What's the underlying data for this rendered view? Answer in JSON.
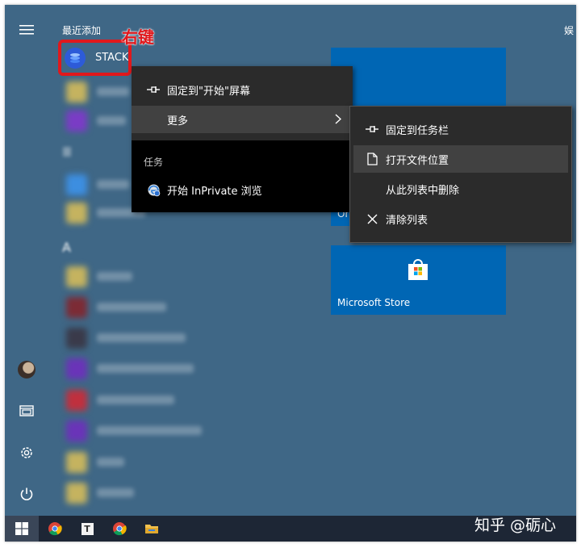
{
  "start_menu": {
    "section_recent": "最近添加",
    "right_edge_label": "娱",
    "apps": [
      {
        "label": "STACK"
      }
    ],
    "group_letter_a": "A"
  },
  "annotation": {
    "label": "右键",
    "color": "#e0181c"
  },
  "context_menu": {
    "items": [
      {
        "label": "固定到\"开始\"屏幕"
      },
      {
        "label": "更多"
      }
    ],
    "tasks_header": "任务",
    "task_item": "开始 InPrivate 浏览"
  },
  "submenu": {
    "items": [
      {
        "label": "固定到任务栏"
      },
      {
        "label": "打开文件位置"
      },
      {
        "label": "从此列表中删除"
      },
      {
        "label": "清除列表"
      }
    ]
  },
  "tiles": {
    "store_label": "Microsoft Store",
    "partial_label": "Or"
  },
  "watermark": "知乎 @砺心",
  "colors": {
    "desktop": "#3f6786",
    "tile": "#0066b4",
    "menu_bg": "#2b2b2b",
    "menu_hover": "#414141",
    "taskbar": "#1d2635"
  },
  "icons": [
    "hamburger-icon",
    "stack-app-icon",
    "pin-icon",
    "chevron-right-icon",
    "edge-icon",
    "file-icon",
    "close-icon",
    "store-icon",
    "avatar",
    "file-explorer-icon",
    "settings-icon",
    "power-icon",
    "windows-logo-icon",
    "chrome-icon",
    "typora-icon",
    "folder-icon"
  ]
}
